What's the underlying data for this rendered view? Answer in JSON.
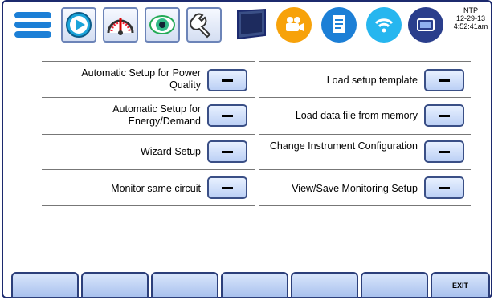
{
  "status": {
    "ntp": "NTP",
    "date": "12-29-13",
    "time": "4:52:41am"
  },
  "toolbar": [
    {
      "icon": "menu-icon"
    },
    {
      "icon": "play-icon"
    },
    {
      "icon": "gauge-icon"
    },
    {
      "icon": "eye-icon"
    },
    {
      "icon": "wrench-icon"
    },
    {
      "icon": "screen-icon"
    },
    {
      "icon": "camera-icon"
    },
    {
      "icon": "document-icon"
    },
    {
      "icon": "wifi-icon"
    },
    {
      "icon": "device-icon"
    }
  ],
  "left_items": [
    {
      "label": "Automatic Setup for Power Quality",
      "button": "–"
    },
    {
      "label": "Automatic Setup for Energy/Demand",
      "button": "–"
    },
    {
      "label": "Wizard Setup",
      "button": "–"
    },
    {
      "label": "Monitor same circuit",
      "button": "–"
    }
  ],
  "right_items": [
    {
      "label": "Load setup template",
      "button": "–"
    },
    {
      "label": "Load data file from memory",
      "button": "–"
    },
    {
      "label": "Change Instrument Configuration",
      "button": "–"
    },
    {
      "label": "View/Save Monitoring Setup",
      "button": "–"
    }
  ],
  "softkeys": [
    "",
    "",
    "",
    "",
    "",
    "",
    "EXIT"
  ],
  "colors": {
    "accent": "#1c2a6e",
    "button_fill": "#bcd0f5",
    "icon_blue": "#1c7fd6"
  }
}
